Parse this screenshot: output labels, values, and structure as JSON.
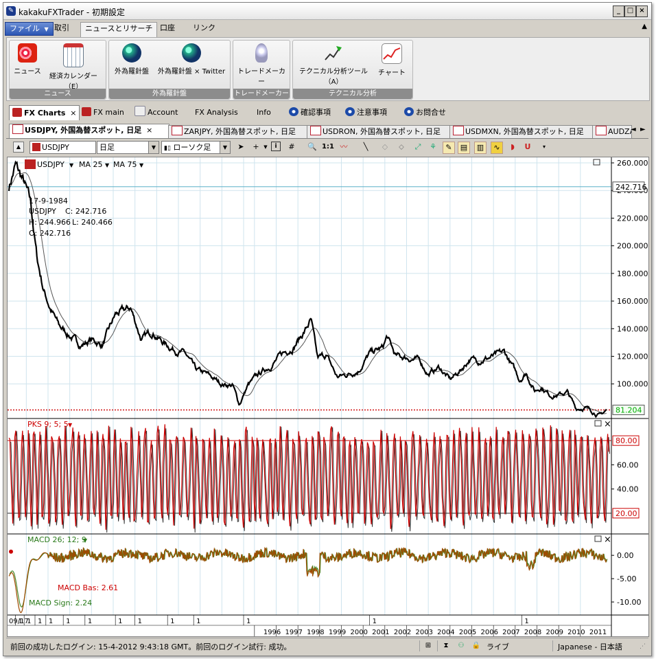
{
  "window": {
    "title": "kakakuFXTrader - 初期設定",
    "app_icon": "kakaku-logo-icon"
  },
  "window_controls": [
    "_",
    "□",
    "×"
  ],
  "menubar": {
    "items": [
      {
        "label": "ファイル",
        "dropdown": "▼"
      },
      {
        "label": "取引"
      },
      {
        "label": "ニュースとリサーチ"
      },
      {
        "label": "口座"
      },
      {
        "label": "リンク"
      }
    ],
    "collapse_icon": "chevron-up-icon"
  },
  "ribbon": {
    "groups": [
      {
        "label": "ニュース",
        "buttons": [
          {
            "label": "ニュース",
            "icon": "news-feed-icon"
          },
          {
            "label": "経済カレンダー（E）",
            "icon": "calendar-icon"
          }
        ]
      },
      {
        "label": "外為羅針盤",
        "buttons": [
          {
            "label": "外為羅針盤",
            "icon": "globe-icon"
          },
          {
            "label": "外為羅針盤 × Twitter",
            "icon": "globe-icon"
          }
        ]
      },
      {
        "label": "トレードメーカー",
        "buttons": [
          {
            "label": "トレードメーカー",
            "icon": "lightbulb-icon"
          }
        ]
      },
      {
        "label": "テクニカル分析",
        "buttons": [
          {
            "label": "テクニカル分析ツール（A）",
            "icon": "trend-line-icon"
          },
          {
            "label": "チャート",
            "icon": "chart-icon"
          }
        ]
      }
    ]
  },
  "tabs": [
    {
      "label": "FX Charts",
      "close": "×"
    },
    {
      "label": "FX main"
    },
    {
      "label": "Account"
    },
    {
      "label": "FX Analysis"
    },
    {
      "label": "Info"
    },
    {
      "label": "確認事項"
    },
    {
      "label": "注意事項"
    },
    {
      "label": "お問合せ"
    }
  ],
  "doc_tabs": [
    {
      "label": "USDJPY, 外国為替スポット, 日足",
      "close": "×"
    },
    {
      "label": "ZARJPY, 外国為替スポット, 日足"
    },
    {
      "label": "USDRON, 外国為替スポット, 日足"
    },
    {
      "label": "USDMXN, 外国為替スポット, 日足"
    },
    {
      "label": "AUDZA"
    }
  ],
  "doc_tab_nav": [
    "◄",
    "►"
  ],
  "toolbar": {
    "symbol": "USDJPY",
    "timeframe": "日足",
    "chart_type": "ローソク足",
    "ratio_label": "1:1"
  },
  "colors": {
    "price_line": "#000000",
    "ma_line": "#555555",
    "pks_line": "#cc0000",
    "macd_line": "#a04a00",
    "macd_signal": "#4a8a2a",
    "level_line": "#cc0000",
    "cursor_line": "#5ab0c8",
    "grid": "#cfe4ee"
  },
  "price_panel": {
    "symbol": "USDJPY",
    "indicators": [
      "MA 25",
      "MA 75"
    ],
    "info": {
      "date": "17-9-1984",
      "symbol": "USDJPY",
      "close_label": "C: 242.716",
      "high_label": "H: 244.966",
      "low_label": "L: 240.466",
      "open_label": "O: 242.716"
    },
    "cursor_price": "242.716",
    "last_price": "81.204",
    "y_ticks": [
      "260.000",
      "240.000",
      "220.000",
      "200.000",
      "180.000",
      "160.000",
      "140.000",
      "120.000",
      "100.000"
    ]
  },
  "pks_panel": {
    "label": "PKS 9; 5; 5",
    "y_ticks": [
      "60.00",
      "40.00"
    ],
    "upper_level": "80.00",
    "lower_level": "20.00"
  },
  "macd_panel": {
    "label": "MACD 26; 12; 9",
    "y_ticks": [
      "0.00",
      "-5.00",
      "-10.00"
    ],
    "macd_bas": "MACD Bas: 2.61",
    "macd_sign": "MACD Sign: 2.24"
  },
  "time_axis": {
    "start_label": "09/17",
    "years": [
      "1996",
      "1997",
      "1998",
      "1999",
      "2000",
      "2001",
      "2002",
      "2003",
      "2004",
      "2005",
      "2006",
      "2007",
      "2008",
      "2009",
      "2010",
      "2011"
    ],
    "month_marks": [
      "1",
      "1",
      "1",
      "1",
      "1",
      "1",
      "1",
      "1",
      "1",
      "1",
      "1",
      "1",
      "1"
    ]
  },
  "statusbar": {
    "message": "前回の成功したログイン: 15-4-2012 9:43:18 GMT。前回のログイン試行: 成功。",
    "connection": "ライブ",
    "language": "Japanese - 日本語"
  },
  "chart_data": [
    {
      "type": "line",
      "name": "USDJPY price (daily)",
      "x_range": [
        "1984-09-17",
        "2012-04-13"
      ],
      "x": [
        1984.7,
        1985.0,
        1985.4,
        1985.7,
        1986.0,
        1986.3,
        1986.6,
        1987.0,
        1987.5,
        1988.0,
        1988.5,
        1989.0,
        1989.6,
        1990.3,
        1990.8,
        1991.3,
        1991.8,
        1992.3,
        1992.8,
        1993.3,
        1993.8,
        1994.5,
        1995.0,
        1995.3,
        1995.7,
        1996.2,
        1996.8,
        1997.3,
        1997.8,
        1998.3,
        1998.6,
        1998.9,
        1999.3,
        1999.8,
        2000.3,
        2000.8,
        2001.3,
        2001.9,
        2002.1,
        2002.5,
        2003.0,
        2003.6,
        2004.0,
        2004.5,
        2005.0,
        2005.5,
        2005.9,
        2006.3,
        2006.8,
        2007.2,
        2007.5,
        2007.9,
        2008.2,
        2008.5,
        2008.9,
        2009.2,
        2009.6,
        2010.0,
        2010.4,
        2010.8,
        2011.2,
        2011.6,
        2011.9,
        2012.2
      ],
      "y": [
        242.7,
        258,
        245,
        230,
        190,
        168,
        155,
        142,
        135,
        128,
        132,
        128,
        150,
        155,
        132,
        138,
        130,
        125,
        122,
        110,
        107,
        100,
        99,
        85,
        99,
        107,
        114,
        122,
        127,
        138,
        146,
        118,
        121,
        105,
        107,
        110,
        122,
        126,
        134,
        120,
        119,
        117,
        107,
        112,
        103,
        110,
        118,
        117,
        119,
        121,
        123,
        112,
        103,
        108,
        95,
        98,
        92,
        92,
        94,
        82,
        83,
        80,
        77,
        81.2
      ],
      "y_range": [
        76,
        262
      ],
      "ylabel": "",
      "overlays": [
        "MA 25",
        "MA 75"
      ],
      "cursor_value": 242.716,
      "last_value": 81.204
    },
    {
      "type": "line",
      "name": "PKS 9; 5; 5",
      "y_range": [
        4,
        96
      ],
      "levels": [
        80,
        20
      ]
    },
    {
      "type": "line",
      "name": "MACD 26; 12; 9",
      "y_range": [
        -12.5,
        4
      ],
      "last_macd_bas": 2.61,
      "last_macd_sign": 2.24
    }
  ]
}
